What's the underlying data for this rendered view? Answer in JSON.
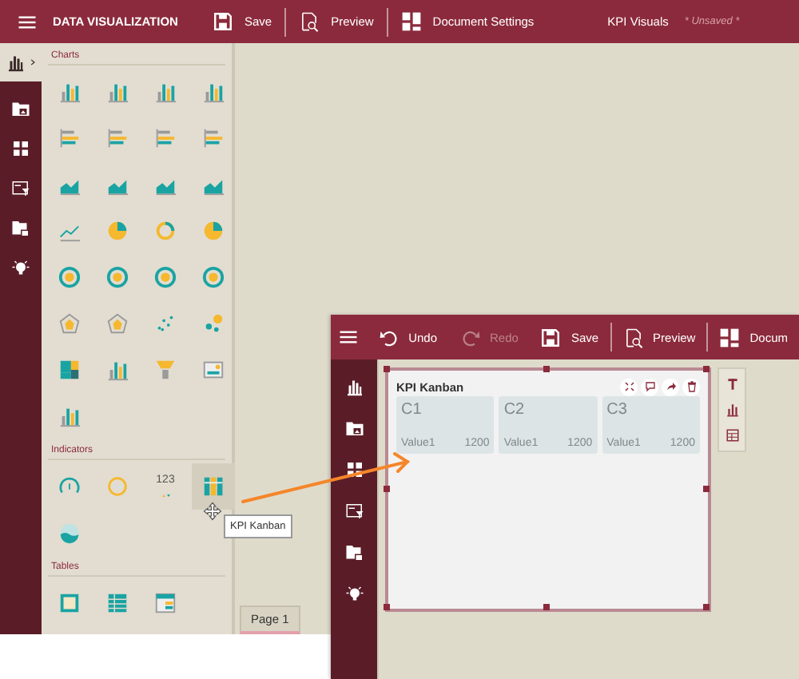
{
  "header": {
    "title": "DATA VISUALIZATION",
    "actions": [
      {
        "kind": "save",
        "label": "Save",
        "disabled": false
      },
      {
        "kind": "preview",
        "label": "Preview",
        "disabled": false
      },
      {
        "kind": "settings",
        "label": "Document Settings",
        "disabled": false
      }
    ],
    "document": "KPI Visuals",
    "status": "* Unsaved *"
  },
  "sidebar": [
    {
      "selected": true
    },
    {
      "selected": false
    },
    {
      "selected": false
    },
    {
      "selected": false
    },
    {
      "selected": false
    },
    {
      "selected": false
    }
  ],
  "palette": [
    {
      "title": "Charts",
      "kind": "charts",
      "items": [
        {
          "hovered": false
        },
        {
          "hovered": false
        },
        {
          "hovered": false
        },
        {
          "hovered": false
        },
        {
          "hovered": false
        },
        {
          "hovered": false
        },
        {
          "hovered": false
        },
        {
          "hovered": false
        },
        {
          "hovered": false
        },
        {
          "hovered": false
        },
        {
          "hovered": false
        },
        {
          "hovered": false
        },
        {
          "hovered": false
        },
        {
          "hovered": false
        },
        {
          "hovered": false
        },
        {
          "hovered": false
        },
        {
          "hovered": false
        },
        {
          "hovered": false
        },
        {
          "hovered": false
        },
        {
          "hovered": false
        },
        {
          "hovered": false
        },
        {
          "hovered": false
        },
        {
          "hovered": false
        },
        {
          "hovered": false
        },
        {
          "hovered": false
        },
        {
          "hovered": false
        },
        {
          "hovered": false
        },
        {
          "hovered": false
        },
        {
          "hovered": false
        }
      ]
    },
    {
      "title": "Indicators",
      "kind": "indicators",
      "items": [
        {
          "hovered": false
        },
        {
          "hovered": false
        },
        {
          "hovered": false,
          "label": "123"
        },
        {
          "hovered": true
        },
        {
          "hovered": false
        }
      ]
    },
    {
      "title": "Tables",
      "kind": "tables",
      "items": [
        {
          "hovered": false
        },
        {
          "hovered": false
        },
        {
          "hovered": false
        }
      ]
    }
  ],
  "tooltip": "KPI Kanban",
  "pages": [
    {
      "label": "Page 1",
      "selected": true
    }
  ],
  "inset": {
    "actions": [
      {
        "kind": "undo",
        "label": "Undo",
        "disabled": false
      },
      {
        "kind": "redo",
        "label": "Redo",
        "disabled": true
      },
      {
        "kind": "save",
        "label": "Save",
        "disabled": false
      },
      {
        "kind": "preview",
        "label": "Preview",
        "disabled": false
      },
      {
        "kind": "settings",
        "label": "Docum",
        "disabled": false
      }
    ],
    "sidebar": [
      {
        "selected": false
      },
      {
        "selected": false
      },
      {
        "selected": false
      },
      {
        "selected": false
      },
      {
        "selected": false
      },
      {
        "selected": false
      }
    ],
    "widget": {
      "title": "KPI Kanban",
      "cards": [
        {
          "title": "C1",
          "label": "Value1",
          "value": "1200"
        },
        {
          "title": "C2",
          "label": "Value1",
          "value": "1200"
        },
        {
          "title": "C3",
          "label": "Value1",
          "value": "1200"
        }
      ]
    }
  }
}
